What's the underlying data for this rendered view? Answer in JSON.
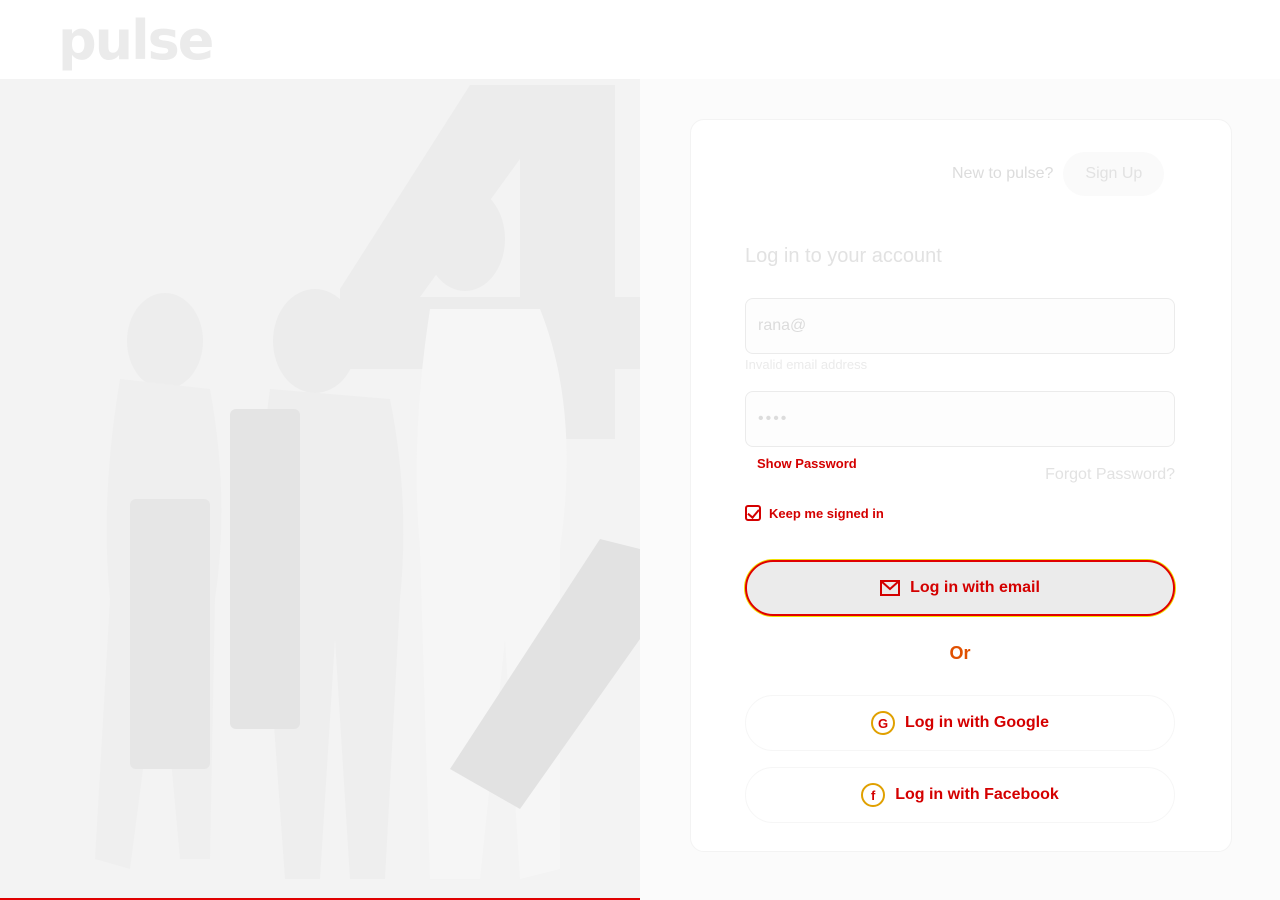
{
  "brand": {
    "logo": "pulse"
  },
  "signup": {
    "prompt": "New to pulse?",
    "button": "Sign Up"
  },
  "login": {
    "heading": "Log in to your account",
    "email_value": "rana@",
    "email_error": "Invalid email address",
    "password_value": "••••",
    "show_password": "Show Password",
    "forgot_password": "Forgot Password?",
    "keep_signed_in": "Keep me signed in",
    "email_button": "Log in with email",
    "divider": "Or",
    "google_button": "Log in with Google",
    "facebook_button": "Log in with Facebook"
  },
  "icons": {
    "email": "envelope-icon",
    "google": "google-icon",
    "facebook": "facebook-icon",
    "checkbox": "checkmark-icon"
  },
  "colors": {
    "accent": "#d40000",
    "outline": "#f0e000"
  }
}
